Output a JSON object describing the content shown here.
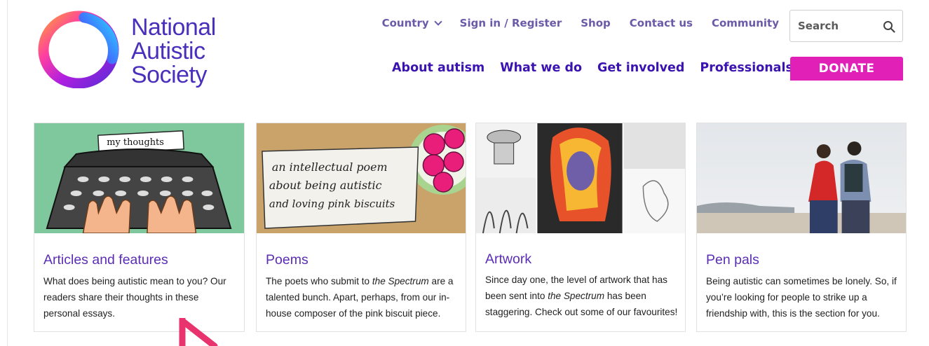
{
  "logo": {
    "line1": "National",
    "line2": "Autistic",
    "line3": "Society"
  },
  "utility_nav": {
    "country": "Country",
    "sign_in": "Sign in / Register",
    "shop": "Shop",
    "contact": "Contact us",
    "community": "Community"
  },
  "search": {
    "placeholder": "Search",
    "icon": "search-icon"
  },
  "main_nav": {
    "about": "About autism",
    "what": "What we do",
    "involved": "Get involved",
    "professionals": "Professionals",
    "donate": "DONATE"
  },
  "colors": {
    "brand_purple": "#3b13b0",
    "donate_pink": "#e020b6",
    "card_title": "#5b2db5"
  },
  "cards": [
    {
      "title": "Articles and features",
      "desc": "What does being autistic mean to you? Our readers share their thoughts in these personal essays.",
      "image_label": "my thoughts"
    },
    {
      "title": "Poems",
      "desc_pre": "The poets who submit to ",
      "desc_em": "the Spectrum",
      "desc_post": " are a talented bunch. Apart, perhaps, from our in-house composer of the pink biscuit piece.",
      "image_line1": "an intellectual poem",
      "image_line2": "about being autistic",
      "image_line3": "and loving pink biscuits"
    },
    {
      "title": "Artwork",
      "desc_pre": "Since day one, the level of artwork that has been sent into ",
      "desc_em": "the Spectrum",
      "desc_post": " has been staggering. Check out some of our favourites!"
    },
    {
      "title": "Pen pals",
      "desc": "Being autistic can sometimes be lonely. So, if you’re looking for people to strike up a friendship with, this is the section for you."
    }
  ]
}
